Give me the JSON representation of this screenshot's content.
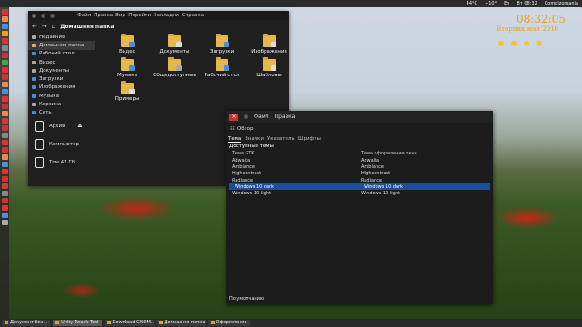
{
  "top_panel": {
    "temp": "44°C",
    "weather": "+10°",
    "keyboard": "En",
    "time": "Вт 08:32",
    "user": "Compizomania"
  },
  "file_manager": {
    "menu": [
      "Файл",
      "Правка",
      "Вид",
      "Перейти",
      "Закладки",
      "Справка"
    ],
    "path": "Домашняя папка",
    "sidebar": [
      {
        "label": "Недавние",
        "color": "#aaaaaa"
      },
      {
        "label": "Домашняя папка",
        "color": "#e6b84c"
      },
      {
        "label": "Рабочий стол",
        "color": "#4a90d9"
      },
      {
        "label": "Видео",
        "color": "#aaaaaa"
      },
      {
        "label": "Документы",
        "color": "#aaaaaa"
      },
      {
        "label": "Загрузки",
        "color": "#4a90d9"
      },
      {
        "label": "Изображения",
        "color": "#4a90d9"
      },
      {
        "label": "Музыка",
        "color": "#4a90d9"
      },
      {
        "label": "Корзина",
        "color": "#aaaaaa"
      },
      {
        "label": "Сеть",
        "color": "#4a90d9"
      }
    ],
    "devices": [
      "Архив",
      "Компьютер",
      "Том 47 ГБ"
    ],
    "eject_icon": "eject-icon",
    "folders": [
      {
        "label": "Видео",
        "badge": "#4a90d9"
      },
      {
        "label": "Документы",
        "badge": "#dddddd"
      },
      {
        "label": "Загрузки",
        "badge": "#4a90d9"
      },
      {
        "label": "Изображения",
        "badge": "#dddddd"
      },
      {
        "label": "Музыка",
        "badge": "#4a90d9"
      },
      {
        "label": "Общедоступные",
        "badge": "#aaaaaa"
      },
      {
        "label": "Рабочий стол",
        "badge": "#4a90d9"
      },
      {
        "label": "Шаблоны",
        "badge": "#dddddd"
      },
      {
        "label": "Примеры",
        "badge": "#dddddd"
      }
    ]
  },
  "tweak_tool": {
    "menu": [
      "Файл",
      "Правка"
    ],
    "overview": "Обзор",
    "tabs": [
      "Тема",
      "Значки",
      "Указатель",
      "Шрифты"
    ],
    "heading": "Доступные темы",
    "col_gtk": "Тема GTK",
    "col_wm": "Тема оформления окна",
    "rows": [
      {
        "gtk": "Adwaita",
        "wm": "Adwaita"
      },
      {
        "gtk": "Ambiance",
        "wm": "Ambiance"
      },
      {
        "gtk": "Highcontrast",
        "wm": "Highcontrast"
      },
      {
        "gtk": "Radiance",
        "wm": "Radiance"
      },
      {
        "gtk": "Windows 10 dark",
        "wm": "Windows 10 dark",
        "selected": true
      },
      {
        "gtk": "Windows 10 light",
        "wm": "Windows 10 light"
      }
    ],
    "default_button": "По умолчанию"
  },
  "conky": {
    "clock": "08:32:05",
    "date_prefix": "Вторник",
    "date_suffix": "май 2016"
  },
  "taskbar": [
    {
      "label": "Документ без...",
      "active": false
    },
    {
      "label": "Unity Tweak Tool",
      "active": true
    },
    {
      "label": "Download GNOM...",
      "active": false
    },
    {
      "label": "Домашняя папка",
      "active": false
    },
    {
      "label": "Оформление",
      "active": false
    }
  ],
  "colors": {
    "launcher": [
      "#d33",
      "#e85",
      "#4a90d9",
      "#f0a020",
      "#d33",
      "#888",
      "#c33",
      "#4a4",
      "#d33",
      "#c33",
      "#e85",
      "#4a90d9",
      "#d33",
      "#c33",
      "#e85",
      "#d33",
      "#c33",
      "#888",
      "#d33",
      "#c33",
      "#e85",
      "#4a90d9",
      "#d33",
      "#c33",
      "#d33",
      "#888",
      "#c33",
      "#d33",
      "#4a90d9",
      "#aaaaaa"
    ]
  }
}
